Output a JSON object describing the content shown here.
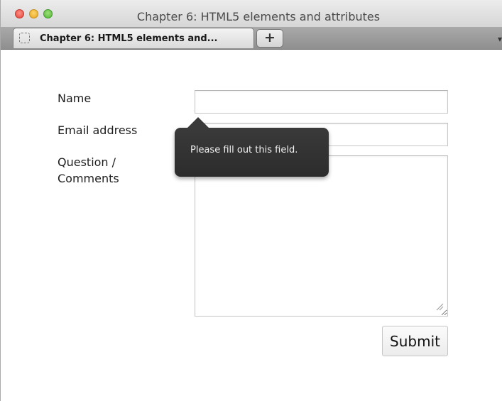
{
  "window": {
    "title": "Chapter 6: HTML5 elements and attributes"
  },
  "tabs": [
    {
      "label": "Chapter 6: HTML5 elements and..."
    }
  ],
  "new_tab_label": "+",
  "tab_menu_icon": "chevron-down-icon",
  "form": {
    "name_label": "Name",
    "name_value": "",
    "email_label": "Email address",
    "email_value": "",
    "comments_label_line1": "Question /",
    "comments_label_line2": "Comments",
    "comments_value": "",
    "submit_label": "Submit"
  },
  "tooltip": {
    "message": "Please fill out this field."
  },
  "colors": {
    "close": "#e0443a",
    "minimize": "#e3a521",
    "maximize": "#4fb533",
    "tooltip_bg": "#2c2c2c"
  }
}
